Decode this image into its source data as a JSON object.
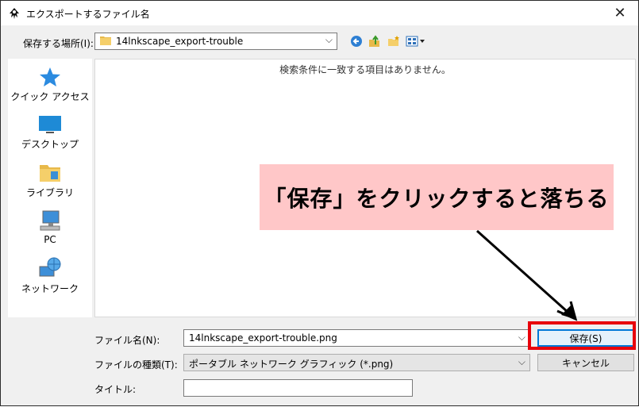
{
  "window": {
    "title": "エクスポートするファイル名",
    "close_glyph": "✕"
  },
  "location": {
    "label": "保存する場所(I):",
    "value": "14lnkscape_export-trouble",
    "dropdown_glyph": "⌵"
  },
  "places": [
    {
      "label": "クイック アクセス",
      "icon": "star-icon"
    },
    {
      "label": "デスクトップ",
      "icon": "desktop-icon"
    },
    {
      "label": "ライブラリ",
      "icon": "library-icon"
    },
    {
      "label": "PC",
      "icon": "pc-icon"
    },
    {
      "label": "ネットワーク",
      "icon": "network-icon"
    }
  ],
  "file_list": {
    "empty_message": "検索条件に一致する項目はありません。"
  },
  "annotation": {
    "text": "「保存」をクリックすると落ちる",
    "highlight_color": "#e8000b",
    "callout_bg": "#ffc7c8"
  },
  "form": {
    "filename": {
      "label": "ファイル名(N):",
      "value": "14lnkscape_export-trouble.png"
    },
    "filetype": {
      "label": "ファイルの種類(T):",
      "value": "ポータブル ネットワーク グラフィック (*.png)"
    },
    "title": {
      "label": "タイトル:",
      "value": ""
    }
  },
  "buttons": {
    "save": "保存(S)",
    "cancel": "キャンセル"
  },
  "colors": {
    "accent": "#0078d7"
  }
}
